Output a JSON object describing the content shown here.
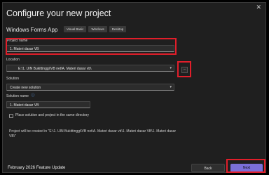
{
  "window": {
    "title": "Configure your new project",
    "close_glyph": "✕"
  },
  "template": {
    "name": "Windows Forms App",
    "tags": [
      "Visual Basic",
      "Windows",
      "Desktop"
    ]
  },
  "form": {
    "project_name_label": "Project name",
    "project_name_value": "1. Materi dasar VB",
    "location_label": "Location",
    "location_value": "E:\\1. UIN Bukittinggi\\VB net\\A. Materi dasar vb\\",
    "browse_label": "...",
    "solution_label": "Solution",
    "solution_value": "Create new solution",
    "solution_name_label": "Solution name",
    "solution_name_value": "1. Materi dasar VB",
    "checkbox_label": "Place solution and project in the same directory",
    "note": "Project will be created in \"E:\\1. UIN Bukittinggi\\VB net\\A. Materi dasar vb\\1. Materi dasar VB\\1. Materi dasar VB\\\""
  },
  "footer": {
    "update_text": "February 2026 Feature Update",
    "back_label": "Back",
    "next_label": "Next"
  },
  "colors": {
    "background": "#1f1f1f",
    "accent": "#7b6fd8",
    "highlight": "#e11e2a"
  }
}
